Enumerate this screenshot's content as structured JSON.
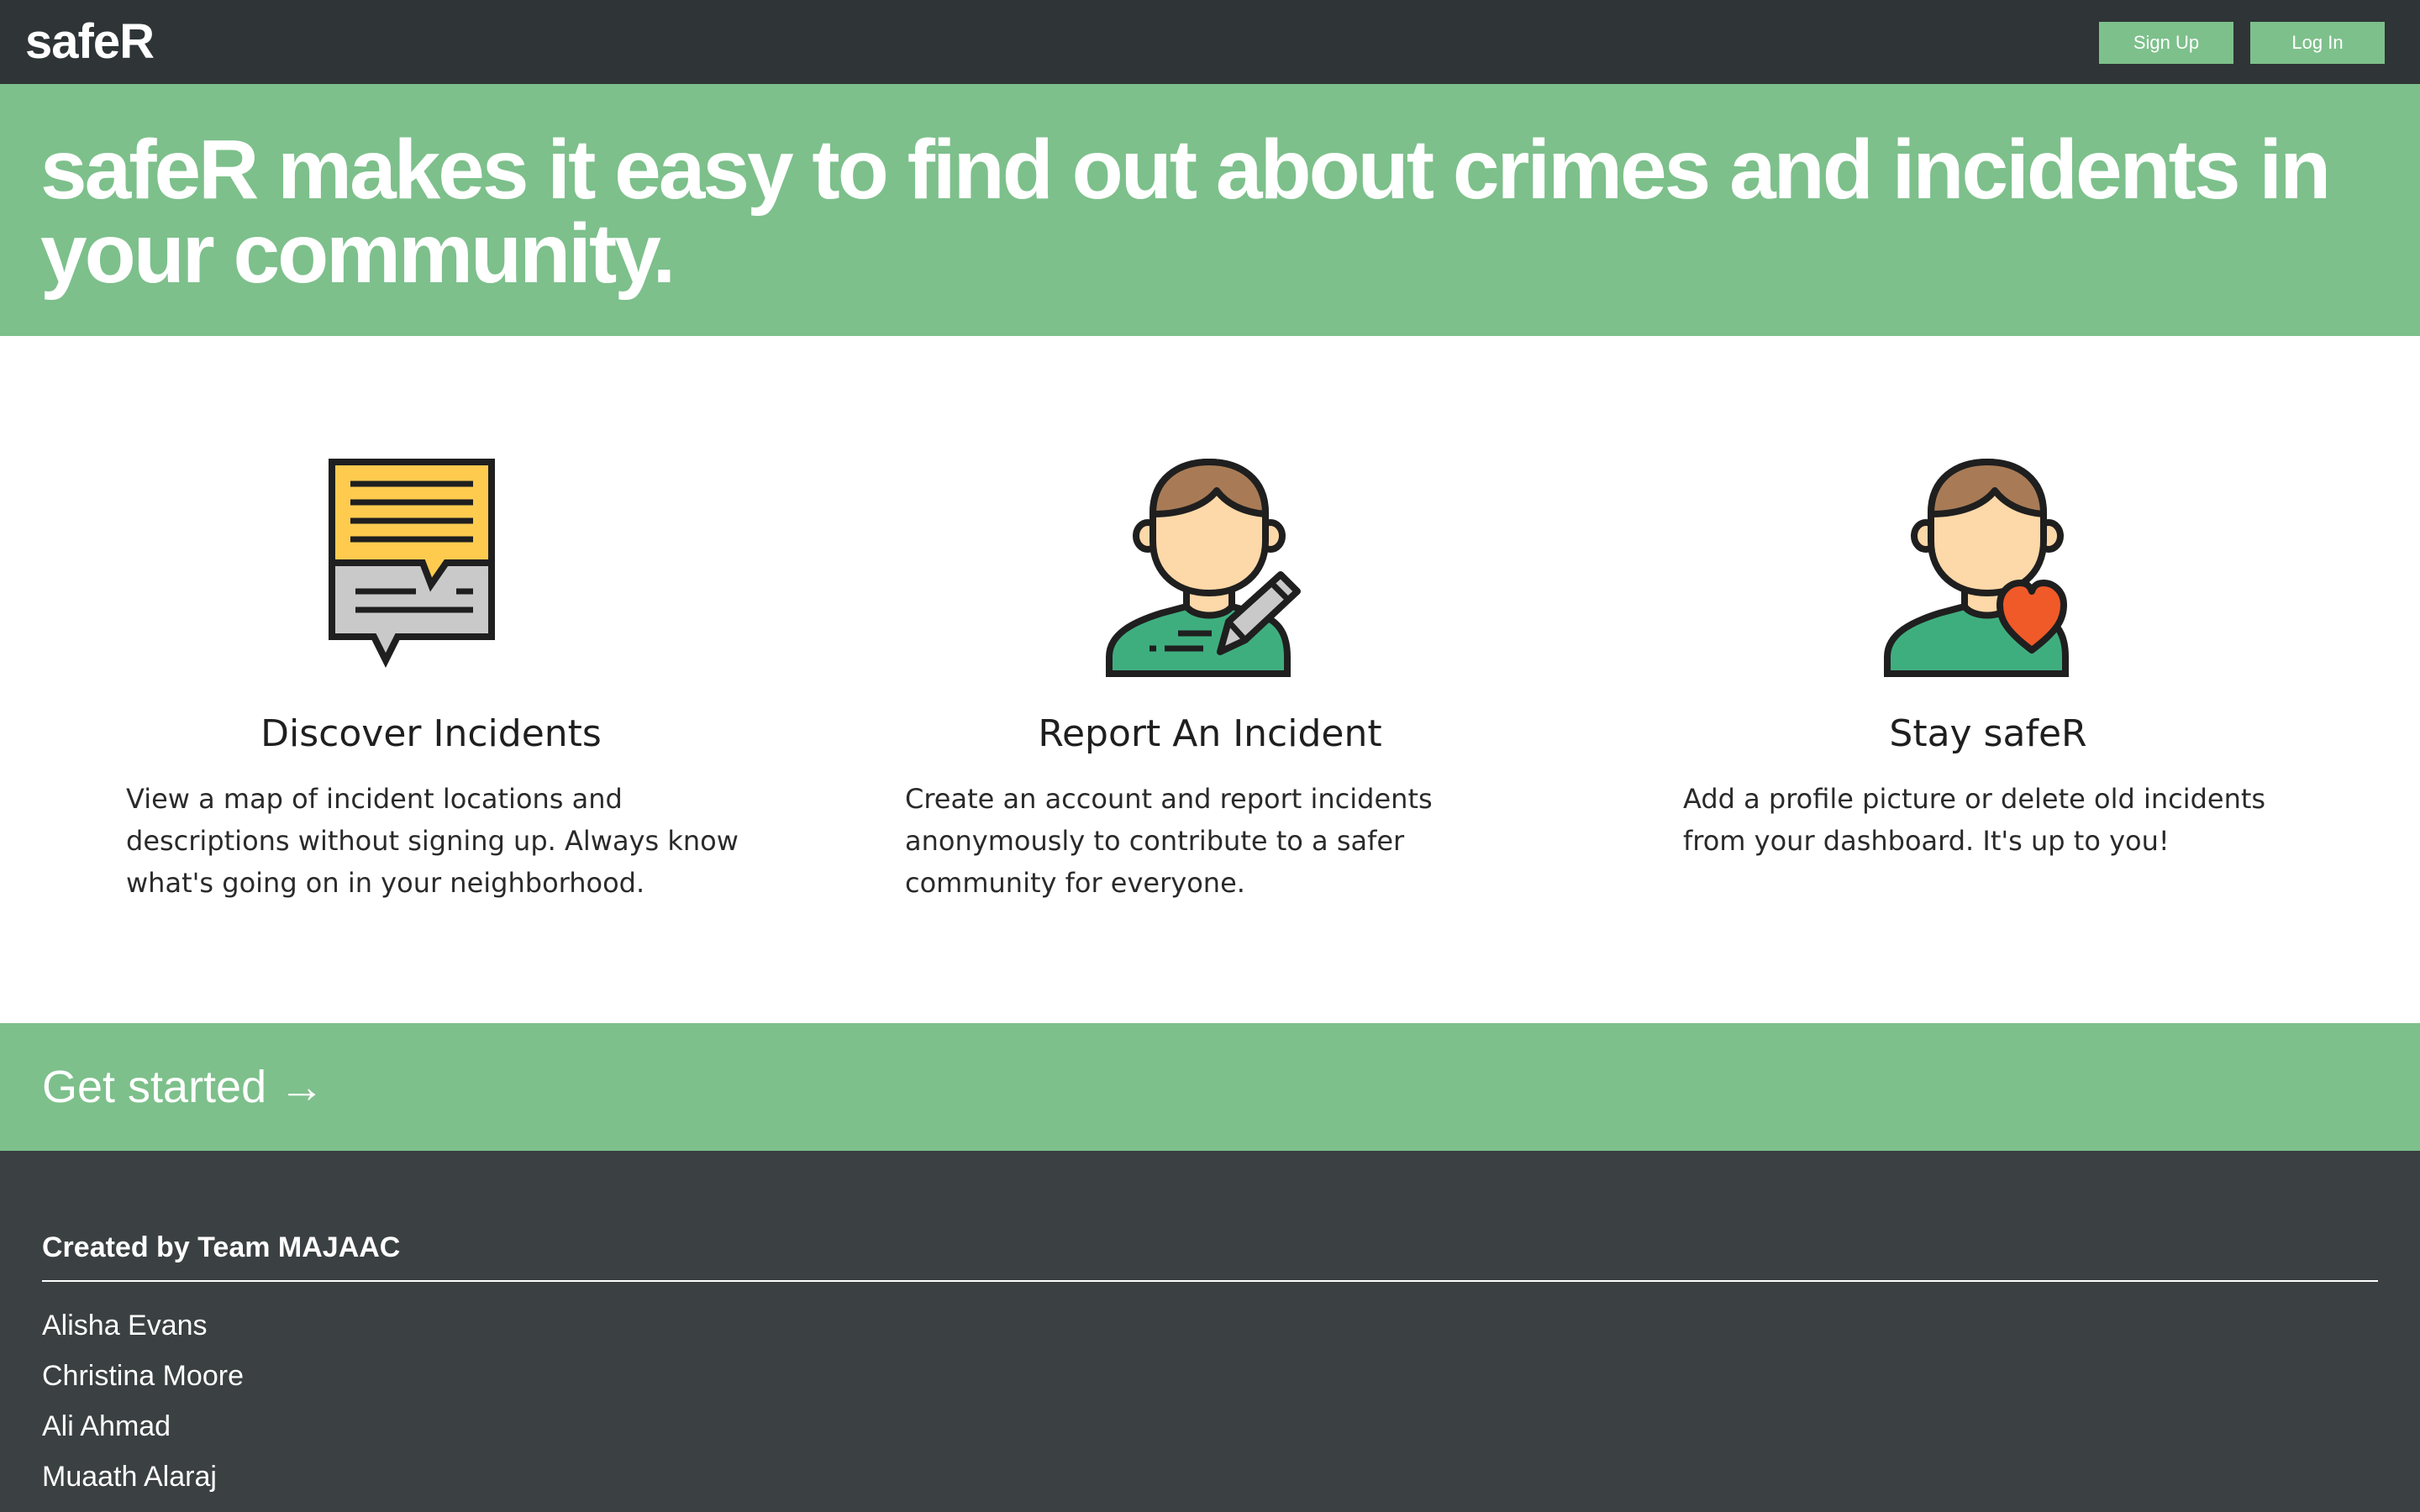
{
  "nav": {
    "brand": "safeR",
    "signup_label": "Sign Up",
    "login_label": "Log In"
  },
  "hero": {
    "headline": "safeR makes it easy to find out about crimes and incidents in your community."
  },
  "features": [
    {
      "icon": "speech-bubbles-icon",
      "title": "Discover Incidents",
      "text": "View a map of incident locations and descriptions without signing up. Always know what's going on in your neighborhood."
    },
    {
      "icon": "person-pencil-icon",
      "title": "Report An Incident",
      "text": "Create an account and report incidents anonymously to contribute to a safer community for everyone."
    },
    {
      "icon": "person-heart-icon",
      "title": "Stay safeR",
      "text": "Add a profile picture or delete old incidents from your dashboard. It's up to you!"
    }
  ],
  "cta": {
    "label": "Get started →"
  },
  "footer": {
    "heading": "Created by Team MAJAAC",
    "members": [
      "Alisha Evans",
      "Christina Moore",
      "Ali Ahmad",
      "Muaath Alaraj"
    ]
  },
  "colors": {
    "nav_bg": "#2f3436",
    "accent_green": "#7dc08b",
    "footer_bg": "#3b4042",
    "icon_yellow": "#fecb4f",
    "icon_gray": "#c9c9c9",
    "icon_hair": "#a87b56",
    "icon_skin": "#fdd8a8",
    "icon_shirt": "#3fae7f",
    "icon_heart": "#f05a28"
  }
}
